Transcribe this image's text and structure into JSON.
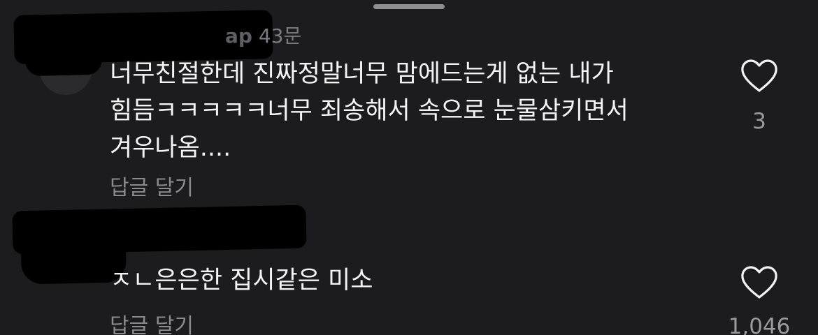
{
  "comments": [
    {
      "username": "ap",
      "time": "43문",
      "text_lines": [
        "너무친절한데 진짜정말너무 맘에드는게 없는 내가",
        "힘듬ㅋㅋㅋㅋㅋ너무 죄송해서 속으로 눈물삼키면서",
        "겨우나옴...."
      ],
      "reply_label": "답글 달기",
      "like_count": "3",
      "like_icon": "heart-outline-icon"
    },
    {
      "text_lines": [
        "ㅈㄴ은은한 집시같은 미소"
      ],
      "reply_label": "답글 달기",
      "like_count": "1,046",
      "like_icon": "heart-outline-icon"
    }
  ]
}
